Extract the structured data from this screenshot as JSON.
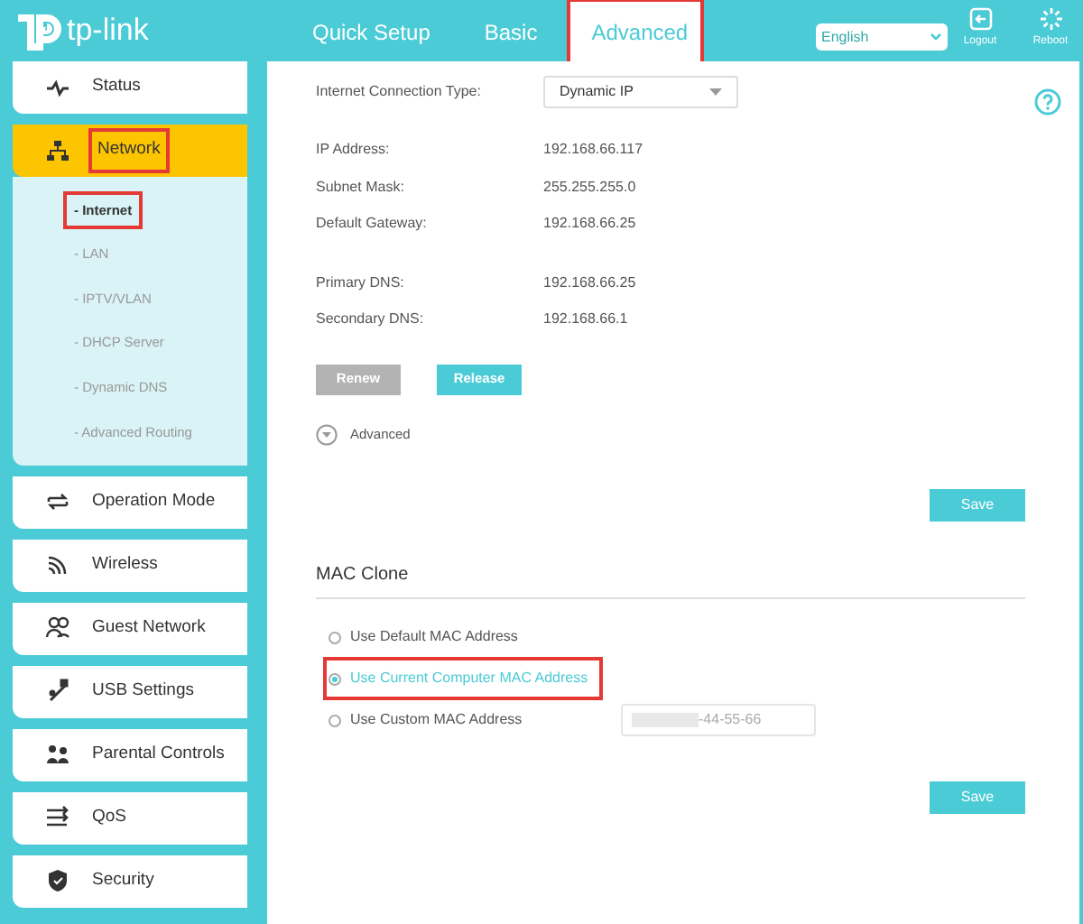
{
  "brand": {
    "name": "tp-link"
  },
  "tabs": [
    {
      "label": "Quick Setup",
      "selected": false,
      "highlighted": false
    },
    {
      "label": "Basic",
      "selected": false,
      "highlighted": false
    },
    {
      "label": "Advanced",
      "selected": true,
      "highlighted": true
    }
  ],
  "language": {
    "value": "English"
  },
  "header_actions": [
    {
      "kind": "logout",
      "label": "Logout"
    },
    {
      "kind": "reboot",
      "label": "Reboot"
    }
  ],
  "sidebar": {
    "items": [
      {
        "kind": "status",
        "label": "Status",
        "selected": false,
        "highlighted": false
      },
      {
        "kind": "network",
        "label": "Network",
        "selected": true,
        "highlighted": true,
        "expanded": true,
        "children": [
          {
            "label": "- Internet",
            "selected": true,
            "highlighted": true
          },
          {
            "label": "- LAN",
            "selected": false,
            "highlighted": false
          },
          {
            "label": "- IPTV/VLAN",
            "selected": false,
            "highlighted": false
          },
          {
            "label": "- DHCP Server",
            "selected": false,
            "highlighted": false
          },
          {
            "label": "- Dynamic DNS",
            "selected": false,
            "highlighted": false
          },
          {
            "label": "- Advanced Routing",
            "selected": false,
            "highlighted": false
          }
        ]
      },
      {
        "kind": "operation",
        "label": "Operation Mode",
        "selected": false,
        "highlighted": false
      },
      {
        "kind": "wireless",
        "label": "Wireless",
        "selected": false,
        "highlighted": false
      },
      {
        "kind": "guest",
        "label": "Guest Network",
        "selected": false,
        "highlighted": false
      },
      {
        "kind": "usb",
        "label": "USB Settings",
        "selected": false,
        "highlighted": false
      },
      {
        "kind": "parental",
        "label": "Parental Controls",
        "selected": false,
        "highlighted": false
      },
      {
        "kind": "qos",
        "label": "QoS",
        "selected": false,
        "highlighted": false
      },
      {
        "kind": "security",
        "label": "Security",
        "selected": false,
        "highlighted": false
      }
    ]
  },
  "internet": {
    "connection_type": {
      "label": "Internet Connection Type:",
      "value": "Dynamic IP"
    },
    "address_fields": [
      {
        "label": "IP Address:",
        "value": "192.168.66.117"
      },
      {
        "label": "Subnet Mask:",
        "value": "255.255.255.0"
      },
      {
        "label": "Default Gateway:",
        "value": "192.168.66.25"
      }
    ],
    "dns_fields": [
      {
        "label": "Primary DNS:",
        "value": "192.168.66.25"
      },
      {
        "label": "Secondary DNS:",
        "value": "192.168.66.1"
      }
    ],
    "buttons": [
      {
        "label": "Renew",
        "disabled": true
      },
      {
        "label": "Release",
        "disabled": false
      }
    ],
    "advanced": {
      "label": "Advanced",
      "expanded": false
    },
    "save": "Save"
  },
  "mac_clone": {
    "title": "MAC Clone",
    "options": [
      {
        "label": "Use Default MAC Address",
        "selected": false,
        "highlighted": false
      },
      {
        "label": "Use Current Computer MAC Address",
        "selected": true,
        "highlighted": true
      },
      {
        "label": "Use Custom MAC Address",
        "selected": false,
        "highlighted": false,
        "field_value": "-44-55-66"
      }
    ],
    "save": "Save"
  }
}
